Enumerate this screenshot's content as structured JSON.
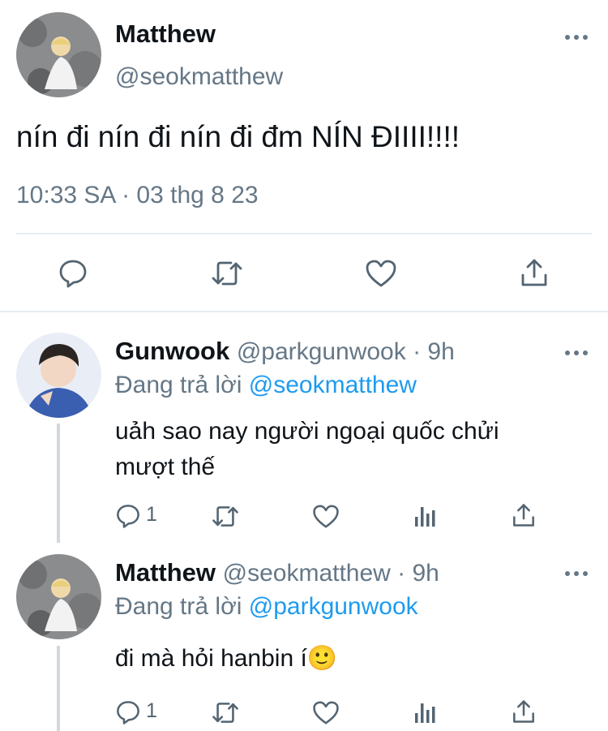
{
  "main_tweet": {
    "name": "Matthew",
    "handle": "@seokmatthew",
    "text": "nín đi nín đi nín đi đm NÍN ĐIIII!!!!",
    "timestamp": "10:33 SA · 03 thg 8 23",
    "actions": [
      "reply-icon",
      "retweet-icon",
      "like-icon",
      "share-icon"
    ]
  },
  "replies": [
    {
      "name": "Gunwook",
      "handle": "@parkgunwook · 9h",
      "replying_prefix": "Đang trả lời ",
      "replying_to": "@seokmatthew",
      "text_line1": "uảh sao nay người ngoại quốc chửi",
      "text_line2": "mượt thế",
      "reply_count": "1"
    },
    {
      "name": "Matthew",
      "handle": "@seokmatthew · 9h",
      "replying_prefix": "Đang trả lời ",
      "replying_to": "@parkgunwook",
      "text_line1": "đi mà hỏi hanbin í🙂",
      "reply_count": "1"
    }
  ],
  "colors": {
    "accent": "#1d9bf0",
    "secondary_text": "#657786",
    "divider": "#e6ecf0"
  }
}
